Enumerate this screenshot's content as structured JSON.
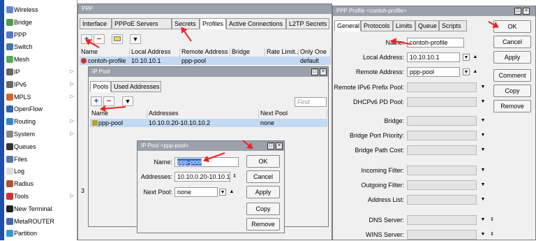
{
  "sidebar": {
    "items": [
      {
        "label": "Wireless",
        "icon": "wireless-icon",
        "color": "#6688cc",
        "arrow": false
      },
      {
        "label": "Bridge",
        "icon": "bridge-icon",
        "color": "#4aa04a",
        "arrow": false
      },
      {
        "label": "PPP",
        "icon": "ppp-icon",
        "color": "#5577cc",
        "arrow": false
      },
      {
        "label": "Switch",
        "icon": "switch-icon",
        "color": "#4477aa",
        "arrow": false
      },
      {
        "label": "Mesh",
        "icon": "mesh-icon",
        "color": "#55aa55",
        "arrow": false
      },
      {
        "label": "IP",
        "icon": "ip-icon",
        "color": "#666666",
        "arrow": true
      },
      {
        "label": "IPv6",
        "icon": "ipv6-icon",
        "color": "#666666",
        "arrow": true
      },
      {
        "label": "MPLS",
        "icon": "mpls-icon",
        "color": "#cc6633",
        "arrow": true
      },
      {
        "label": "OpenFlow",
        "icon": "openflow-icon",
        "color": "#3366aa",
        "arrow": false
      },
      {
        "label": "Routing",
        "icon": "routing-icon",
        "color": "#3388cc",
        "arrow": true
      },
      {
        "label": "System",
        "icon": "system-icon",
        "color": "#888888",
        "arrow": true
      },
      {
        "label": "Queues",
        "icon": "queues-icon",
        "color": "#333333",
        "arrow": false
      },
      {
        "label": "Files",
        "icon": "files-icon",
        "color": "#5577aa",
        "arrow": false
      },
      {
        "label": "Log",
        "icon": "log-icon",
        "color": "#dddddd",
        "arrow": false
      },
      {
        "label": "Radius",
        "icon": "radius-icon",
        "color": "#aa5533",
        "arrow": false
      },
      {
        "label": "Tools",
        "icon": "tools-icon",
        "color": "#cc3333",
        "arrow": true
      },
      {
        "label": "New Terminal",
        "icon": "terminal-icon",
        "color": "#222222",
        "arrow": false
      },
      {
        "label": "MetaROUTER",
        "icon": "metarouter-icon",
        "color": "#4466aa",
        "arrow": false
      },
      {
        "label": "Partition",
        "icon": "partition-icon",
        "color": "#3399cc",
        "arrow": false
      }
    ]
  },
  "ppp": {
    "title": "PPP",
    "tabs": [
      "Interface",
      "PPPoE Servers",
      "Secrets",
      "Profiles",
      "Active Connections",
      "L2TP Secrets"
    ],
    "active_tab": "Profiles",
    "columns": [
      "Name",
      "Local Address",
      "Remote Address",
      "Bridge",
      "Rate Limit...",
      "Only One"
    ],
    "row": [
      "contoh-profile",
      "10.10.10.1",
      "ppp-pool",
      "",
      "",
      "default"
    ],
    "footer": "3"
  },
  "ippool": {
    "title": "IP Pool",
    "tabs": [
      "Pools",
      "Used Addresses"
    ],
    "find_placeholder": "Find",
    "columns": [
      "Name",
      "Addresses",
      "Next Pool"
    ],
    "row": [
      "ppp-pool",
      "10.10.0.20-10.10.10.2",
      "none"
    ]
  },
  "pooldlg": {
    "title": "IP Pool <ppp-pool>",
    "name_label": "Name:",
    "name_value": "ppp-pool",
    "addresses_label": "Addresses:",
    "addresses_value": "10.10.0.20-10.10.1",
    "nextpool_label": "Next Pool:",
    "nextpool_value": "none",
    "buttons": [
      "OK",
      "Cancel",
      "Apply",
      "Copy",
      "Remove"
    ]
  },
  "profile": {
    "title": "PPP Profile <contoh-profile>",
    "tabs": [
      "General",
      "Protocols",
      "Limits",
      "Queue",
      "Scripts"
    ],
    "fields": [
      {
        "label": "Name:",
        "value": "contoh-profile",
        "enabled": true
      },
      {
        "label": "Local Address:",
        "value": "10.10.10.1",
        "enabled": true
      },
      {
        "label": "Remote Address:",
        "value": "ppp-pool",
        "enabled": true
      },
      {
        "label": "Remote IPv6 Prefix Pool:",
        "value": "",
        "enabled": false
      },
      {
        "label": "DHCPv6 PD Pool:",
        "value": "",
        "enabled": false
      },
      {
        "label": "Bridge:",
        "value": "",
        "enabled": false
      },
      {
        "label": "Bridge Port Priority:",
        "value": "",
        "enabled": false
      },
      {
        "label": "Bridge Path Cost:",
        "value": "",
        "enabled": false
      },
      {
        "label": "Incoming Filter:",
        "value": "",
        "enabled": false
      },
      {
        "label": "Outgoing Filter:",
        "value": "",
        "enabled": false
      },
      {
        "label": "Address List:",
        "value": "",
        "enabled": false
      },
      {
        "label": "DNS Server:",
        "value": "",
        "enabled": false
      },
      {
        "label": "WINS Server:",
        "value": "",
        "enabled": false
      }
    ],
    "buttons": [
      "OK",
      "Cancel",
      "Apply",
      "Comment",
      "Copy",
      "Remove"
    ]
  },
  "accent": "#e22222"
}
